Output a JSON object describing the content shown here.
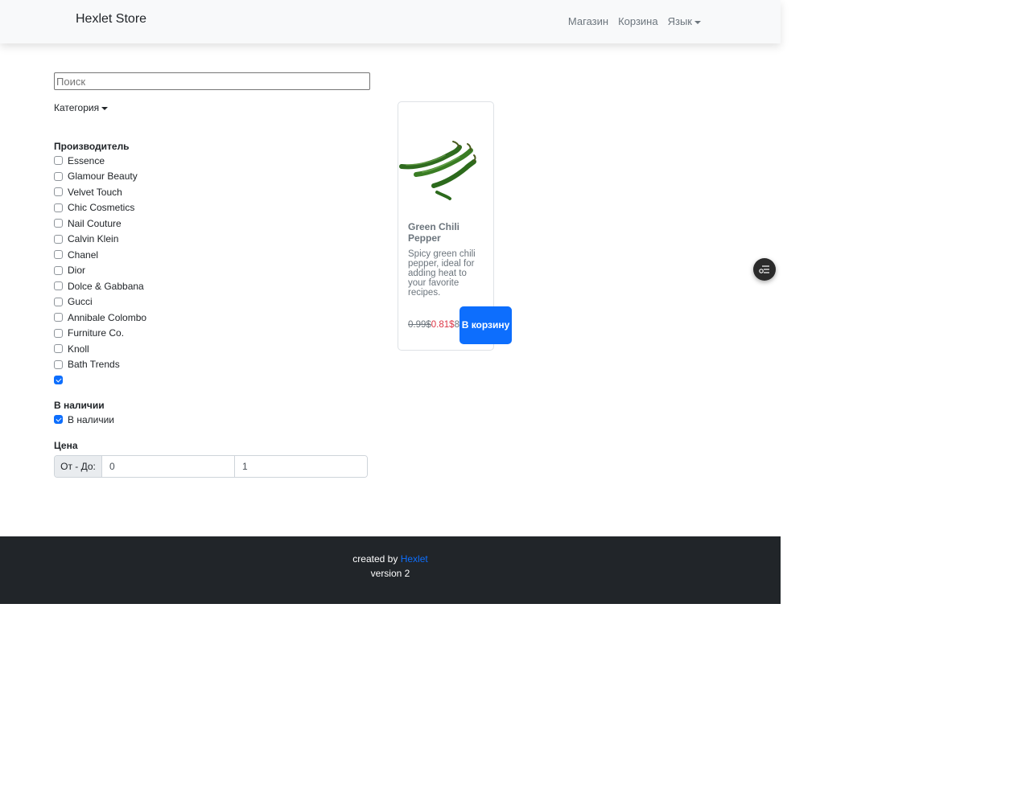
{
  "navbar": {
    "brand": "Hexlet Store",
    "links": [
      "Магазин",
      "Корзина",
      "Язык"
    ]
  },
  "filters": {
    "search_placeholder": "Поиск",
    "category_label": "Категория",
    "manufacturer_title": "Производитель",
    "manufacturers": [
      {
        "label": "Essence",
        "checked": false
      },
      {
        "label": "Glamour Beauty",
        "checked": false
      },
      {
        "label": "Velvet Touch",
        "checked": false
      },
      {
        "label": "Chic Cosmetics",
        "checked": false
      },
      {
        "label": "Nail Couture",
        "checked": false
      },
      {
        "label": "Calvin Klein",
        "checked": false
      },
      {
        "label": "Chanel",
        "checked": false
      },
      {
        "label": "Dior",
        "checked": false
      },
      {
        "label": "Dolce & Gabbana",
        "checked": false
      },
      {
        "label": "Gucci",
        "checked": false
      },
      {
        "label": "Annibale Colombo",
        "checked": false
      },
      {
        "label": "Furniture Co.",
        "checked": false
      },
      {
        "label": "Knoll",
        "checked": false
      },
      {
        "label": "Bath Trends",
        "checked": false
      },
      {
        "label": "",
        "checked": true
      }
    ],
    "stock_title": "В наличии",
    "stock_label": "В наличии",
    "stock_checked": true,
    "price_title": "Цена",
    "price_range_label": "От - До:",
    "price_from": "0",
    "price_to": "1"
  },
  "product": {
    "title": "Green Chili Pepper",
    "description": "Spicy green chili pepper, ideal for adding heat to your favorite recipes.",
    "old_price": "0.99$",
    "new_price": "0.81$",
    "extra": "8",
    "cart_button": "В корзину",
    "image_icon": "green-chili-pepper-image"
  },
  "footer": {
    "created_by": "created by",
    "link": "Hexlet",
    "version": "version 2"
  },
  "colors": {
    "primary": "#0d6efd",
    "danger": "#dc3545",
    "footer_bg": "#212529",
    "navbar_bg": "#f8f9fa"
  }
}
